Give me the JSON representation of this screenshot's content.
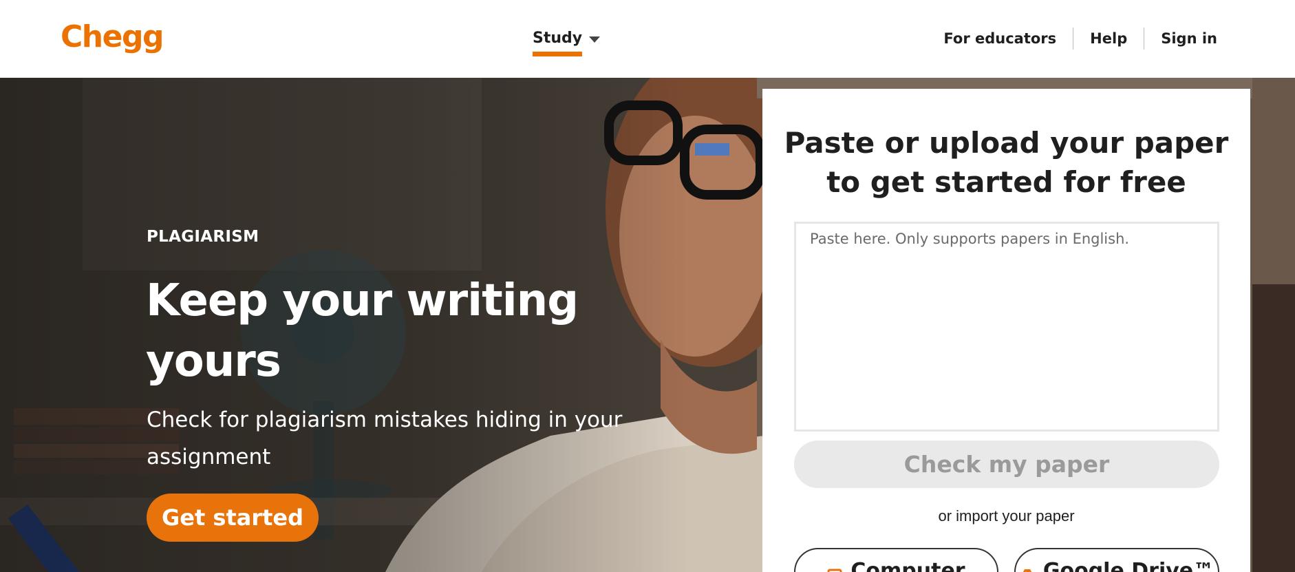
{
  "header": {
    "logo": "Chegg",
    "nav_study": "Study",
    "nav_right": [
      "For educators",
      "Help",
      "Sign in"
    ]
  },
  "hero": {
    "eyebrow": "PLAGIARISM",
    "headline": "Keep your writing yours",
    "subhead": "Check for plagiarism mistakes hiding in your assignment",
    "cta": "Get started"
  },
  "upload_card": {
    "title": "Paste or upload your paper to get started for free",
    "paste_placeholder": "Paste here. Only supports papers in English.",
    "check_button": "Check my paper",
    "or_import": "or import your paper",
    "sources": [
      {
        "label": "Computer",
        "icon": "computer-icon"
      },
      {
        "label": "Google Drive™",
        "icon": "google-drive-icon"
      }
    ]
  },
  "colors": {
    "brand_orange": "#eb7100",
    "cta_orange": "#e8730a",
    "disabled_gray": "#e9e9e9"
  }
}
